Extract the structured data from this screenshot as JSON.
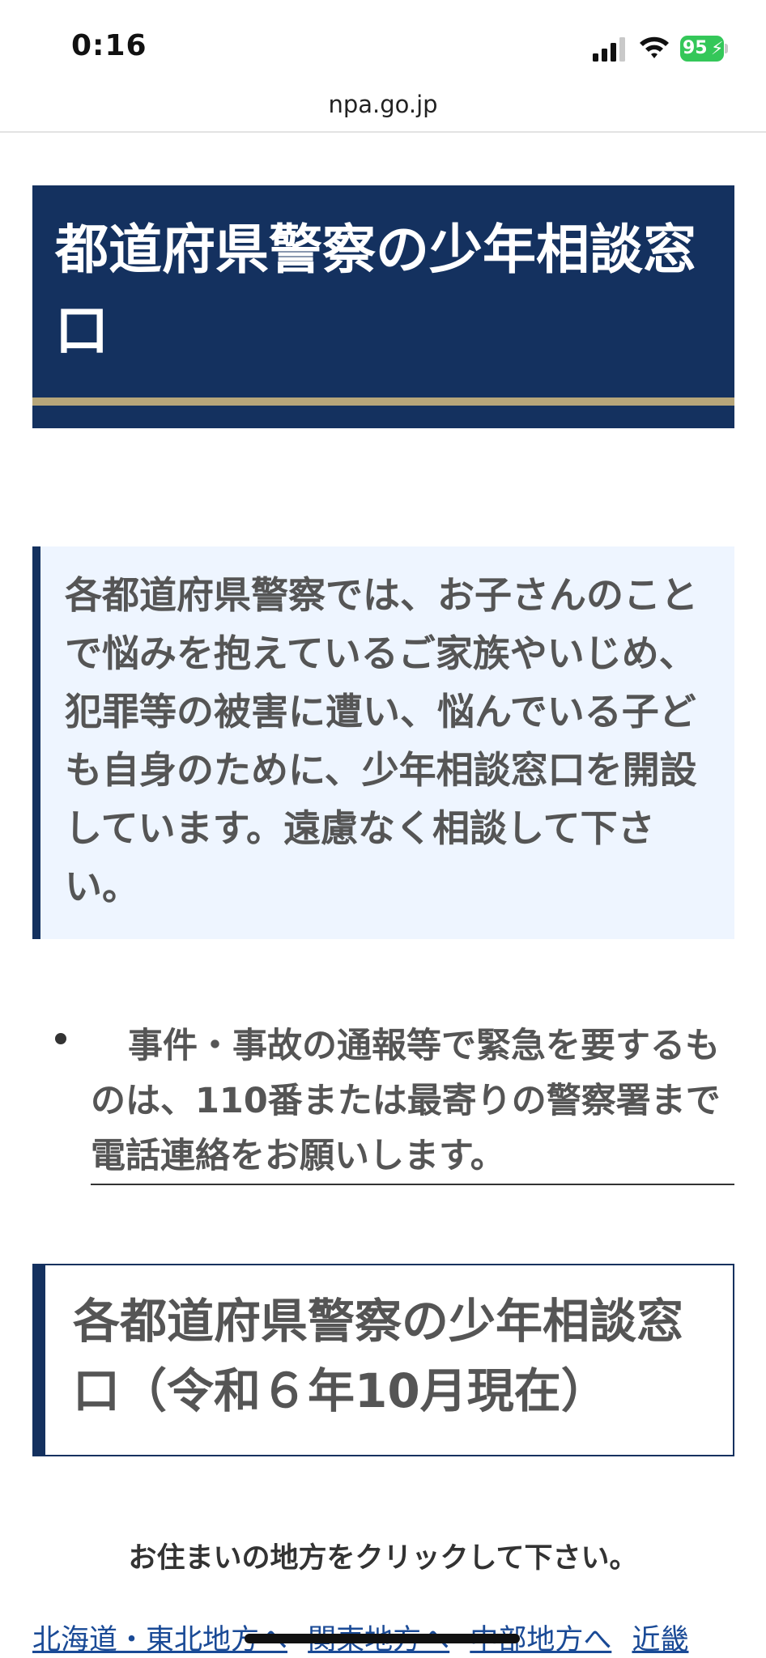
{
  "status_bar": {
    "time": "0:16",
    "battery": "95",
    "icons": [
      "signal-icon",
      "wifi-icon",
      "battery-charging-icon"
    ]
  },
  "browser": {
    "url": "npa.go.jp"
  },
  "page": {
    "title": "都道府県警察の少年相談窓口",
    "intro": "各都道府県警察では、お子さんのことで悩みを抱えているご家族やいじめ、犯罪等の被害に遭い、悩んでいる子ども自身のために、少年相談窓口を開設しています。遠慮なく相談して下さい。",
    "emergency_note": "事件・事故の通報等で緊急を要するものは、110番または最寄りの警察署まで電話連絡をお願いします。",
    "section_heading": "各都道府県警察の少年相談窓口（令和６年10月現在）",
    "instruction": "お住まいの地方をクリックして下さい。",
    "regions": [
      "北海道・東北地方へ",
      "関東地方へ",
      "中部地方へ",
      "近畿"
    ]
  },
  "colors": {
    "navy": "#14315f",
    "gold": "#b7a67a",
    "info_bg": "#eef5ff",
    "link": "#1a4a96"
  }
}
